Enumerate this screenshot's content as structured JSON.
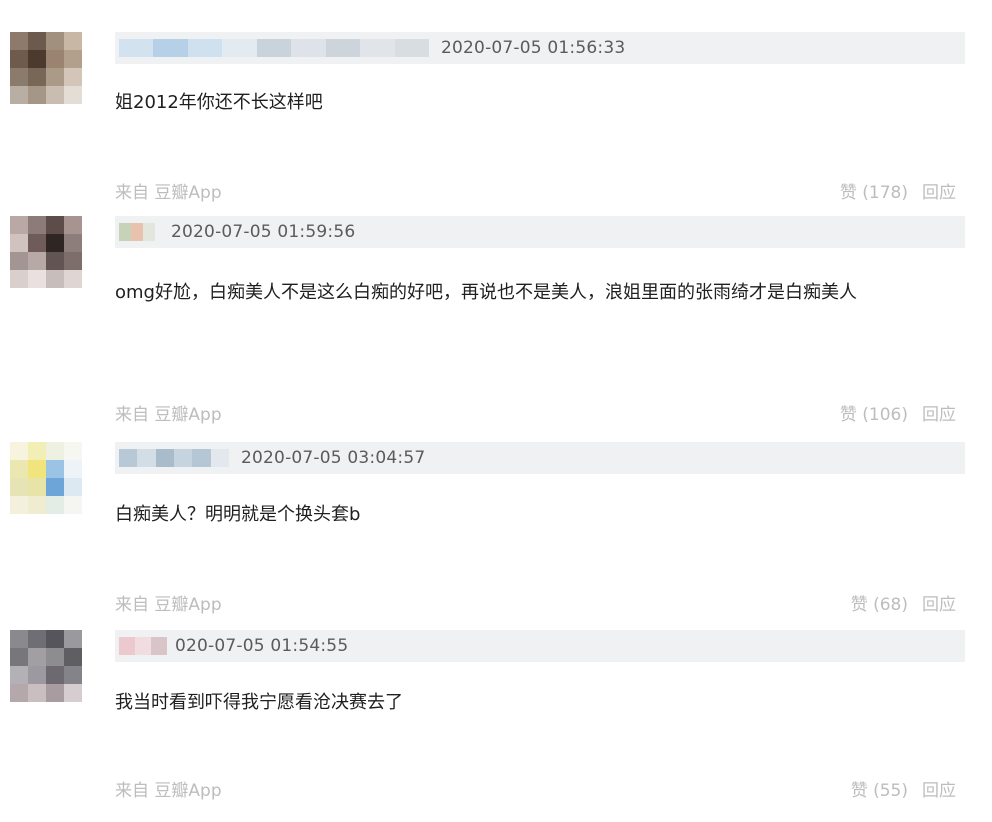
{
  "comments": [
    {
      "time": "2020-07-05 01:56:33",
      "text": "姐2012年你还不长这样吧",
      "source": "来自 豆瓣App",
      "like": "赞 (178)",
      "reply": "回应",
      "avatar": [
        "#8d7a6c",
        "#6c5a4e",
        "#a2907e",
        "#c7b7a4",
        "#6e5b4d",
        "#4c3a2e",
        "#9a8470",
        "#b3a08c",
        "#8b7b6d",
        "#786656",
        "#ab9a88",
        "#d3c6b8",
        "#b9aea3",
        "#a59688",
        "#c9bcb0",
        "#e4ddd5"
      ],
      "uname_blocks": [
        "#d3e2ef",
        "#b6d0e8",
        "#cfe0ee",
        "#e3ebf2",
        "#c9d3dc",
        "#dde3e8",
        "#cdd4db",
        "#e1e5e9",
        "#d8dde2"
      ]
    },
    {
      "time": "2020-07-05 01:59:56",
      "text": "omg好尬，白痴美人不是这么白痴的好吧，再说也不是美人，浪姐里面的张雨绮才是白痴美人",
      "source": "来自 豆瓣App",
      "like": "赞 (106)",
      "reply": "回应",
      "avatar": [
        "#b9a8a3",
        "#8c7b78",
        "#5d4c49",
        "#a79491",
        "#cfc2bf",
        "#6f5b58",
        "#2f2624",
        "#8e7e7b",
        "#a39593",
        "#b6a9a6",
        "#625452",
        "#7d6e6b",
        "#d9d0ce",
        "#e8e1df",
        "#c7bdbb",
        "#dfd6d4"
      ],
      "uname_blocks": [
        "#c7d3b8",
        "#e9c2ae",
        "#e2e6dc"
      ]
    },
    {
      "time": "2020-07-05 03:04:57",
      "text": "白痴美人？明明就是个换头套b",
      "source": "来自 豆瓣App",
      "like": "赞 (68)",
      "reply": "回应",
      "avatar": [
        "#f6f4df",
        "#f2efb6",
        "#eef0e2",
        "#f7f7f2",
        "#ebe7b0",
        "#f1e47d",
        "#9bc4e4",
        "#eef3f7",
        "#e6e4b4",
        "#e8e3a6",
        "#6ea5d8",
        "#dce9f2",
        "#f3f1de",
        "#f0ecd2",
        "#e4ece6",
        "#f5f6f2"
      ],
      "uname_blocks": [
        "#b8c8d6",
        "#d2dde6",
        "#a9bccc",
        "#c6d4e0",
        "#b5c6d5",
        "#e2e8ee"
      ]
    },
    {
      "time": "020-07-05 01:54:55",
      "text": "我当时看到吓得我宁愿看沧决赛去了",
      "source": "来自 豆瓣App",
      "like": "赞 (55)",
      "reply": "回应",
      "avatar": [
        "#8a8a8e",
        "#6f6e74",
        "#56555b",
        "#9a999e",
        "#77767c",
        "#a19fa4",
        "#8d8c91",
        "#5f5e63",
        "#b3b1b5",
        "#9c9aa0",
        "#6c6a70",
        "#85838a",
        "#b4a8ab",
        "#c9bfc1",
        "#a99ca0",
        "#d6cdd0"
      ],
      "uname_blocks": [
        "#ecc9cf",
        "#f1dde0",
        "#d9c4c8"
      ]
    }
  ]
}
